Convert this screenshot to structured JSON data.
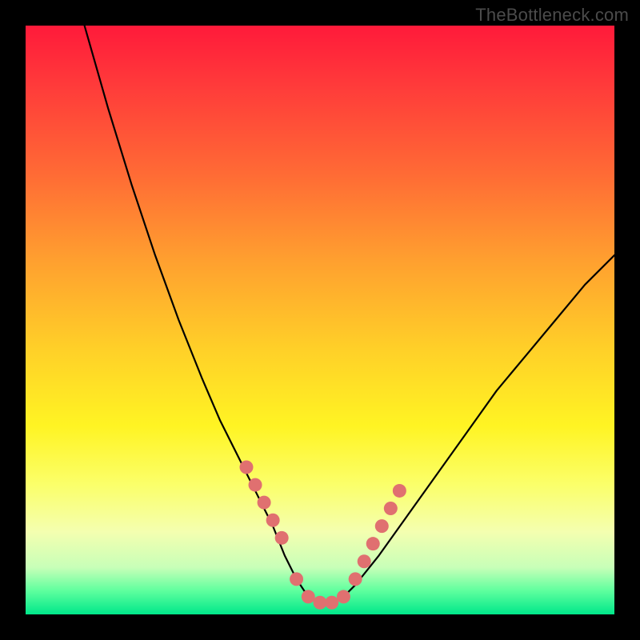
{
  "watermark": "TheBottleneck.com",
  "colors": {
    "frame": "#000000",
    "curve_stroke": "#000000",
    "marker_fill": "#e07070",
    "marker_stroke": "#c85a5a"
  },
  "chart_data": {
    "type": "line",
    "title": "",
    "xlabel": "",
    "ylabel": "",
    "xlim": [
      0,
      100
    ],
    "ylim": [
      0,
      100
    ],
    "grid": false,
    "legend": false,
    "annotations": [],
    "series": [
      {
        "name": "bottleneck-curve",
        "x": [
          10,
          14,
          18,
          22,
          26,
          30,
          33,
          36,
          39,
          42,
          44,
          46,
          48,
          50,
          52,
          54,
          56,
          60,
          65,
          70,
          75,
          80,
          85,
          90,
          95,
          100
        ],
        "y": [
          100,
          86,
          73,
          61,
          50,
          40,
          33,
          27,
          21,
          15,
          10,
          6,
          3,
          2,
          2,
          3,
          5,
          10,
          17,
          24,
          31,
          38,
          44,
          50,
          56,
          61
        ]
      }
    ],
    "markers": {
      "name": "highlight-points",
      "x": [
        37.5,
        39,
        40.5,
        42,
        43.5,
        46,
        48,
        50,
        52,
        54,
        56,
        57.5,
        59,
        60.5,
        62,
        63.5
      ],
      "y": [
        25,
        22,
        19,
        16,
        13,
        6,
        3,
        2,
        2,
        3,
        6,
        9,
        12,
        15,
        18,
        21
      ]
    }
  }
}
